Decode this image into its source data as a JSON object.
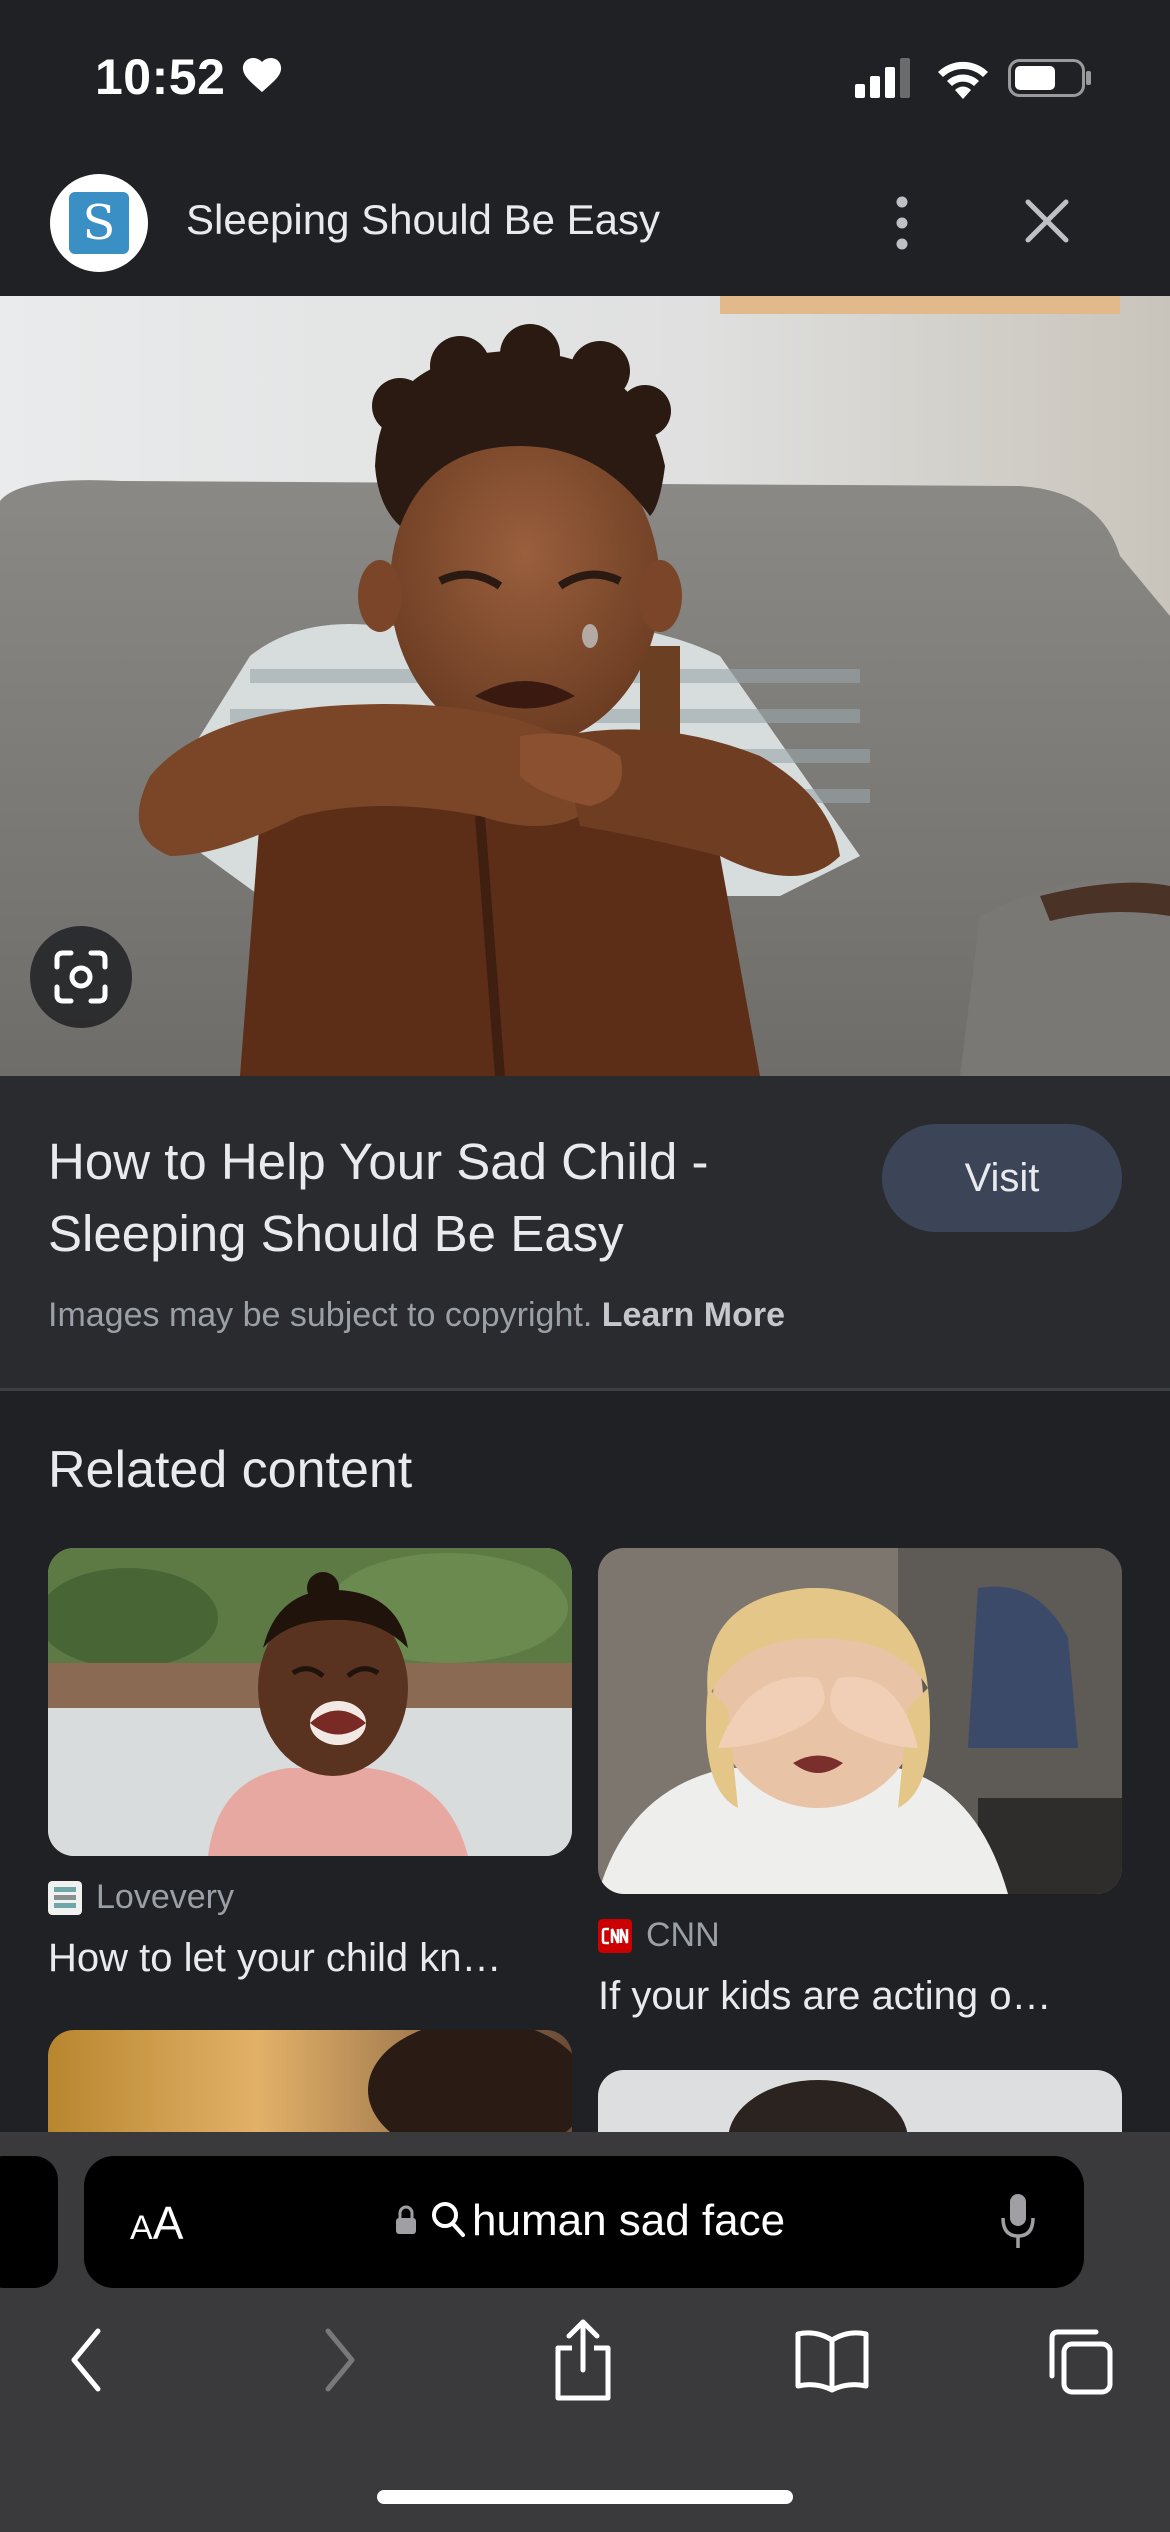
{
  "status_bar": {
    "time": "10:52"
  },
  "header": {
    "site_title": "Sleeping Should Be Easy",
    "logo_letter": "S"
  },
  "info": {
    "title_line1": "How to Help Your Sad Child -",
    "title_line2": "Sleeping Should Be Easy",
    "visit_label": "Visit",
    "copyright_text": "Images may be subject to copyright.",
    "learn_more": "Learn More"
  },
  "related": {
    "heading": "Related content",
    "items": [
      {
        "source": "Lovevery",
        "caption": "How to let your child kn…"
      },
      {
        "source": "CNN",
        "caption": "If your kids are acting o…"
      }
    ]
  },
  "toolbar": {
    "aa_label_small": "A",
    "aa_label_big": "A",
    "search_query": "human sad face"
  },
  "colors": {
    "background": "#202124",
    "panel": "#2a2b2f",
    "visit_button": "#3c4457",
    "toolbar": "#3a3a3c"
  }
}
